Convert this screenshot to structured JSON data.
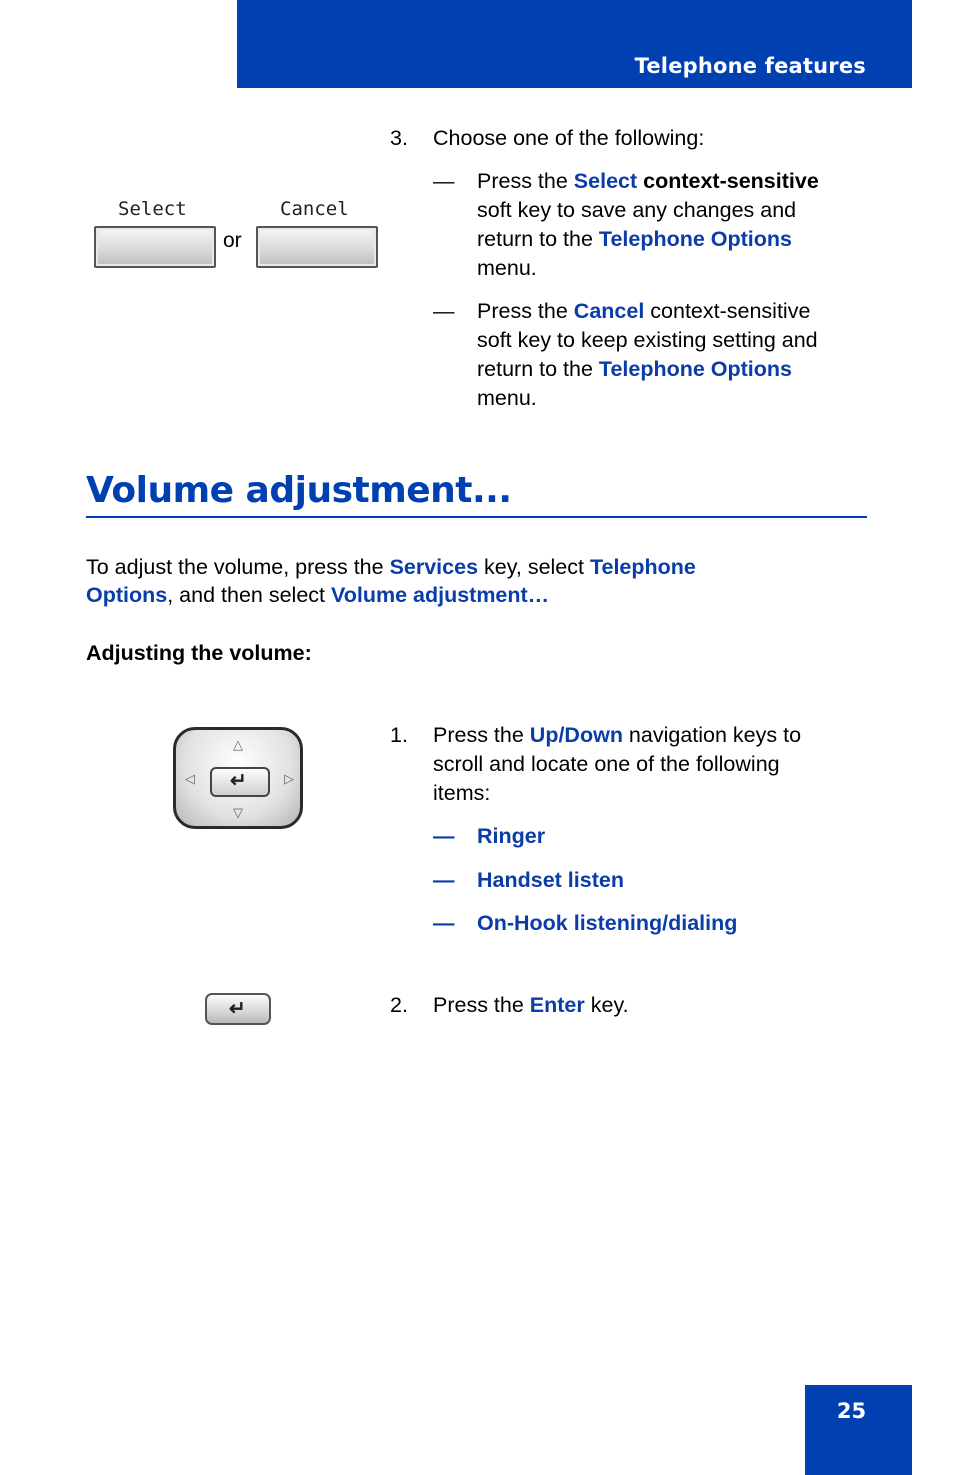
{
  "header": {
    "title": "Telephone features"
  },
  "page_number": "25",
  "top_step": {
    "number": "3.",
    "intro": "Choose one of the following:",
    "softkeys": {
      "left_label": "Select",
      "right_label": "Cancel",
      "or": "or"
    },
    "options": [
      {
        "dash": "—",
        "l1_a": "Press the ",
        "l1_b": "Select",
        "l1_c": " context-sensitive",
        "l2": "soft key to save any changes and",
        "l3_a": "return to the ",
        "l3_b": "Telephone Options",
        "l4": "menu."
      },
      {
        "dash": "—",
        "l1_a": "Press the ",
        "l1_b": "Cancel",
        "l1_c": " context-sensitive",
        "l2": "soft key to keep existing setting and",
        "l3_a": "return to the ",
        "l3_b": "Telephone Options",
        "l4": "menu."
      }
    ]
  },
  "section": {
    "title": "Volume adjustment...",
    "intro_l1_a": "To adjust the volume, press the ",
    "intro_l1_b": "Services",
    "intro_l1_c": " key, select ",
    "intro_l1_d": "Telephone",
    "intro_l2_a": "Options",
    "intro_l2_b": ", and then select ",
    "intro_l2_c": "Volume adjustment…",
    "subheading": "Adjusting the volume:"
  },
  "steps": [
    {
      "number": "1.",
      "l1_a": "Press the ",
      "l1_b": "Up/Down",
      "l1_c": " navigation keys to",
      "l2": "scroll and locate one of the following",
      "l3": "items:",
      "items": [
        {
          "dash": "—",
          "label": "Ringer"
        },
        {
          "dash": "—",
          "label": "Handset listen"
        },
        {
          "dash": "—",
          "label": "On-Hook listening/dialing"
        }
      ]
    },
    {
      "number": "2.",
      "l1_a": "Press the ",
      "l1_b": "Enter",
      "l1_c": " key."
    }
  ],
  "icons": {
    "up": "△",
    "down": "▽",
    "left": "◁",
    "right": "▷",
    "enter": "↵"
  }
}
